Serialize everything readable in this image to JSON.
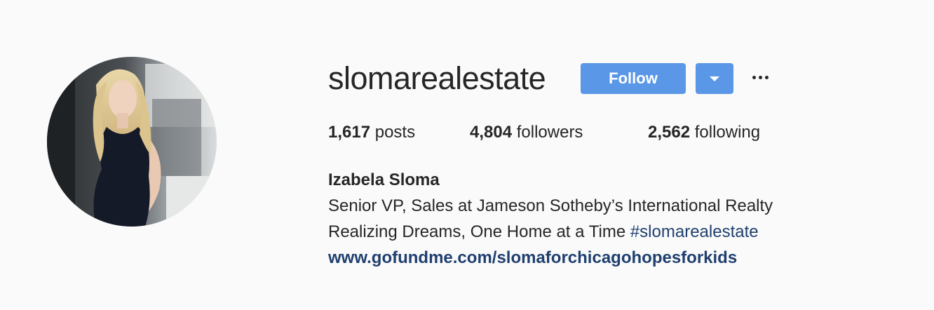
{
  "profile": {
    "username": "slomarealestate",
    "follow_label": "Follow",
    "dropdown_icon": "caret-down-icon",
    "more_icon": "ellipsis-icon",
    "avatar_alt": "profile-photo"
  },
  "stats": {
    "posts_count": "1,617",
    "posts_label": "posts",
    "followers_count": "4,804",
    "followers_label": "followers",
    "following_count": "2,562",
    "following_label": "following"
  },
  "bio": {
    "full_name": "Izabela Sloma",
    "line1": "Senior VP, Sales at Jameson Sotheby’s International Realty",
    "line2_text": "Realizing Dreams, One Home at a Time ",
    "line2_hashtag": "#slomarealestate",
    "website": "www.gofundme.com/slomaforchicagohopesforkids"
  },
  "colors": {
    "accent": "#5a97e6",
    "link": "#1f3f6f",
    "text": "#262626",
    "background": "#fafafa"
  }
}
